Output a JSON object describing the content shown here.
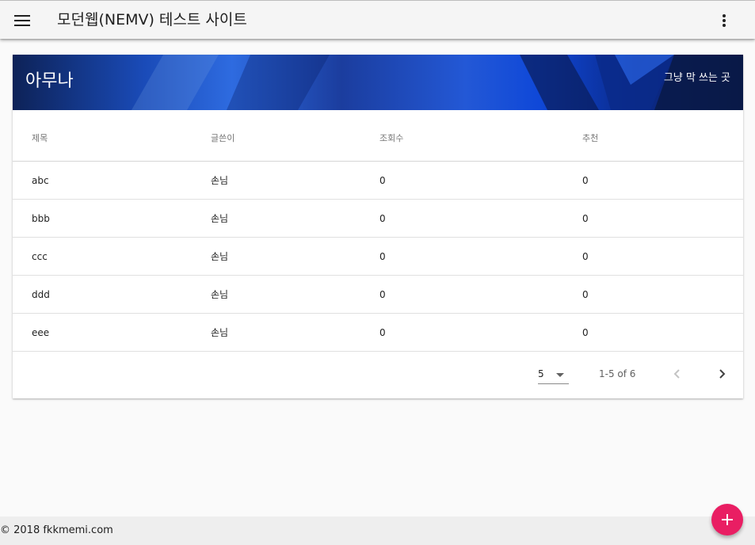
{
  "app": {
    "title": "모던웹(NEMV) 테스트 사이트"
  },
  "icons": {
    "menu": "menu-icon",
    "more": "more-vert-icon",
    "caret": "arrow-drop-down-icon",
    "prev": "chevron-left-icon",
    "next": "chevron-right-icon",
    "add": "add-icon"
  },
  "banner": {
    "title": "아무나",
    "subtitle": "그냥 막 쓰는 곳"
  },
  "table": {
    "headers": [
      "제목",
      "글쓴이",
      "조회수",
      "추천"
    ],
    "rows": [
      [
        "abc",
        "손님",
        "0",
        "0"
      ],
      [
        "bbb",
        "손님",
        "0",
        "0"
      ],
      [
        "ccc",
        "손님",
        "0",
        "0"
      ],
      [
        "ddd",
        "손님",
        "0",
        "0"
      ],
      [
        "eee",
        "손님",
        "0",
        "0"
      ]
    ]
  },
  "pagination": {
    "rows_per_page": "5",
    "range": "1-5 of 6"
  },
  "footer": {
    "copyright": "© 2018 fkkmemi.com"
  },
  "colors": {
    "accent": "#e91e63",
    "banner": "#1a4bb8"
  }
}
